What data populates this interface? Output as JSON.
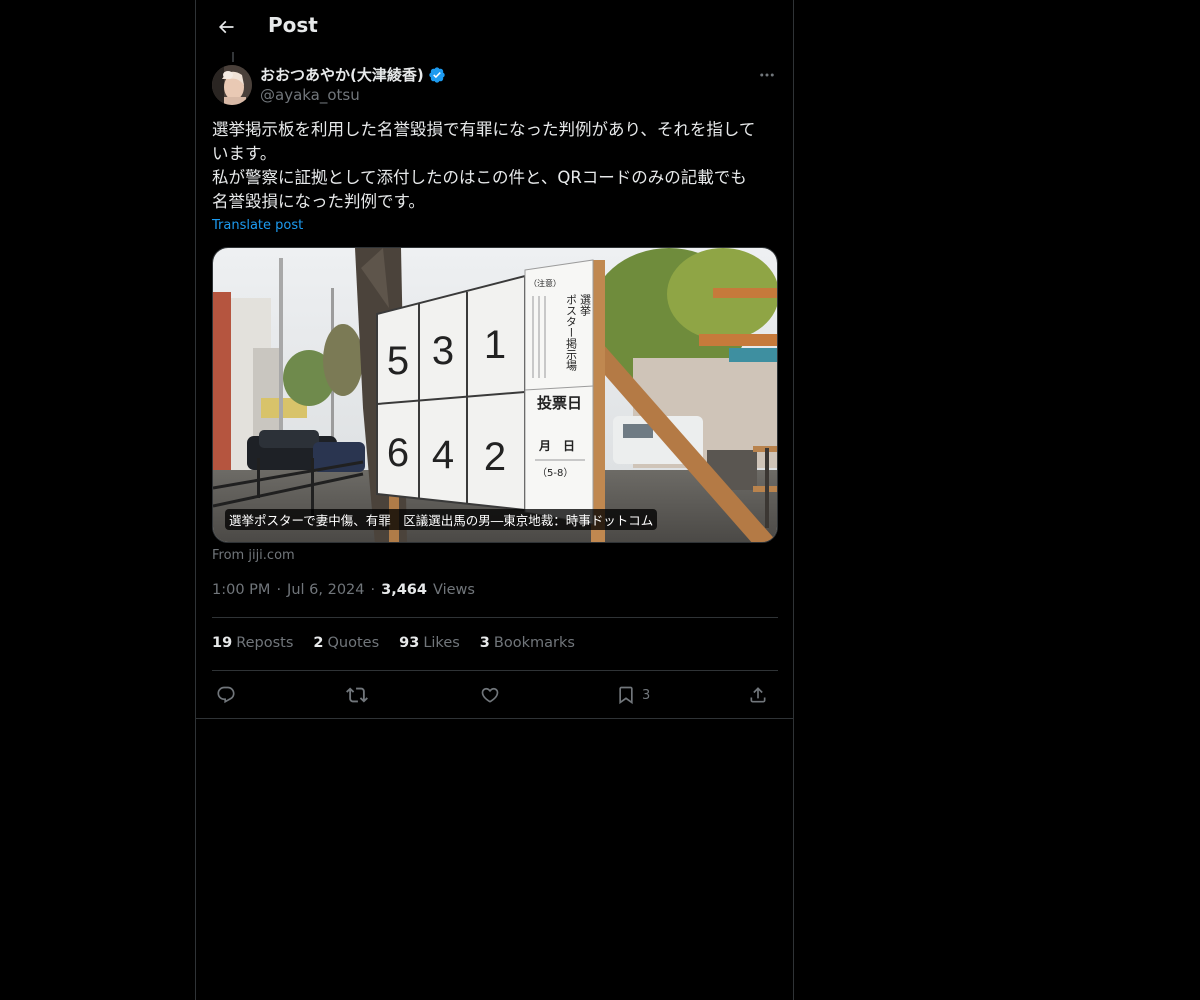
{
  "header": {
    "title": "Post"
  },
  "author": {
    "display_name": "おおつあやか(大津綾香)",
    "handle": "@ayaka_otsu",
    "verified": true
  },
  "post": {
    "lines": [
      "選挙掲示板を利用した名誉毀損で有罪になった判例があり、それを指して",
      "います。",
      "私が警察に証拠として添付したのはこの件と、QRコードのみの記載でも",
      "名誉毀損になった判例です。"
    ],
    "translate_label": "Translate post"
  },
  "card": {
    "caption": "選挙ポスターで妻中傷、有罪　区議選出馬の男―東京地裁：時事ドットコム",
    "source": "From jiji.com",
    "board_numbers": [
      "5",
      "3",
      "1",
      "6",
      "4",
      "2"
    ],
    "sign_title": "ポスター掲示場",
    "sign_header": "選挙",
    "sign_notice": "（注意）",
    "sign_vote_day": "投票日",
    "sign_month_day": "月　日",
    "sign_range": "（5-8）"
  },
  "meta": {
    "time": "1:00 PM",
    "date": "Jul 6, 2024",
    "views_count": "3,464",
    "views_label": "Views",
    "separator": "·"
  },
  "stats": {
    "reposts_count": "19",
    "reposts_label": "Reposts",
    "quotes_count": "2",
    "quotes_label": "Quotes",
    "likes_count": "93",
    "likes_label": "Likes",
    "bookmarks_count": "3",
    "bookmarks_label": "Bookmarks"
  },
  "actions": {
    "bookmark_count": "3"
  },
  "colors": {
    "background": "#000000",
    "text_primary": "#e7e9ea",
    "text_secondary": "#71767b",
    "accent": "#1d9bf0",
    "border": "#2f3336"
  }
}
